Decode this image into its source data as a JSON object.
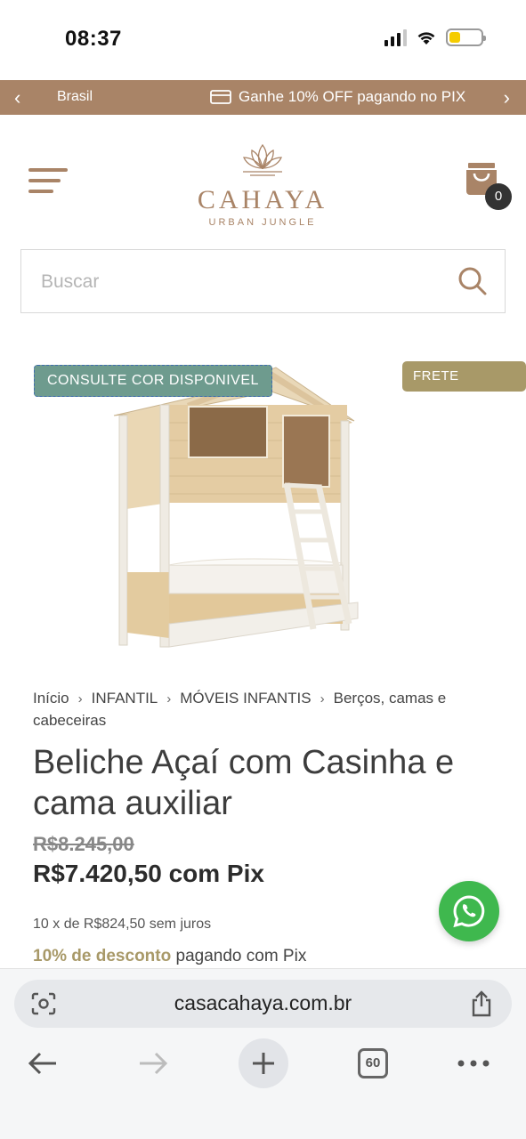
{
  "status_bar": {
    "time": "08:37"
  },
  "promo_bar": {
    "prev_text": "Brasil",
    "message": "Ganhe 10% OFF pagando no PIX",
    "bar_color": "#a98467"
  },
  "header": {
    "logo_name": "CAHAYA",
    "logo_tagline": "URBAN JUNGLE",
    "cart_count": "0",
    "brand_color": "#a98467"
  },
  "search": {
    "placeholder": "Buscar"
  },
  "product": {
    "badge_consult": "CONSULTE COR DISPONIVEL",
    "badge_frete": "FRETE GRÁTIS",
    "breadcrumb": [
      "Início",
      "INFANTIL",
      "MÓVEIS INFANTIS",
      "Berços, camas e cabeceiras"
    ],
    "title": "Beliche Açaí com Casinha e cama auxiliar",
    "old_price": "R$8.245,00",
    "pix_price": "R$7.420,50 com Pix",
    "installments": "10 x de R$824,50 sem juros",
    "discount_highlight": "10% de desconto",
    "discount_rest": "pagando com Pix"
  },
  "browser": {
    "url": "casacahaya.com.br",
    "tabs_count": "60"
  },
  "icons": {
    "promo_prev": "chevron-left-icon",
    "promo_next": "chevron-right-icon",
    "menu": "hamburger-menu-icon",
    "cart": "shopping-bag-icon",
    "search": "search-icon",
    "whatsapp": "whatsapp-icon"
  }
}
